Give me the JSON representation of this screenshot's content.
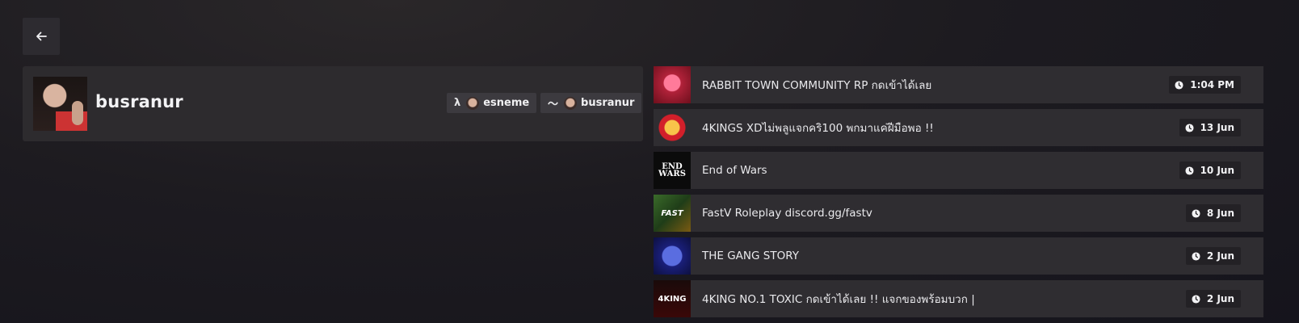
{
  "nav": {
    "back_icon": "arrow-left-icon"
  },
  "profile": {
    "username": "busranur",
    "connections": [
      {
        "icon": "lambda-icon",
        "glyph": "λ",
        "name": "esneme"
      },
      {
        "icon": "wave-icon",
        "glyph": "〜",
        "name": "busranur"
      }
    ]
  },
  "servers": [
    {
      "name": "RABBIT TOWN COMMUNITY RP กดเข้าได้เลย",
      "time": "1:04 PM",
      "thumb": ""
    },
    {
      "name": "4KINGS XDไม่พลูแจกคริ100 พกมาแค่ฝีมือพอ !!",
      "time": "13 Jun",
      "thumb": ""
    },
    {
      "name": "End of Wars",
      "time": "10 Jun",
      "thumb": "END WARS"
    },
    {
      "name": "FastV Roleplay discord.gg/fastv",
      "time": "8 Jun",
      "thumb": "FAST"
    },
    {
      "name": "THE GANG STORY",
      "time": "2 Jun",
      "thumb": ""
    },
    {
      "name": "4KING NO.1 TOXIC กดเข้าได้เลย !! แจกของพร้อมบวก  |",
      "time": "2 Jun",
      "thumb": "4KING"
    }
  ]
}
